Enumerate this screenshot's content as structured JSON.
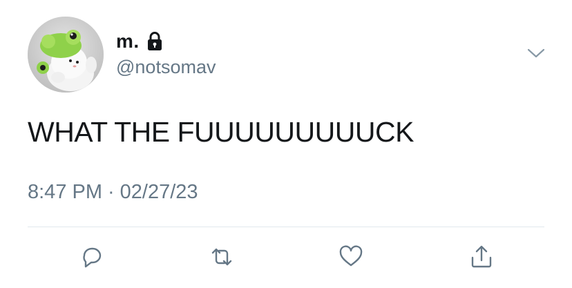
{
  "tweet": {
    "display_name": "m.",
    "username": "@notsomav",
    "text": "WHAT THE FUUUUUUUUUCK",
    "time": "8:47 PM",
    "separator": "·",
    "date": "02/27/23"
  },
  "icons": {
    "account_lock": "lock-icon",
    "menu": "chevron-down-icon",
    "reply": "reply-icon",
    "retweet": "retweet-icon",
    "like": "heart-icon",
    "share": "share-icon"
  },
  "colors": {
    "text_primary": "#14171a",
    "text_secondary": "#657786",
    "icon": "#657786",
    "divider": "#e1e8ed"
  }
}
